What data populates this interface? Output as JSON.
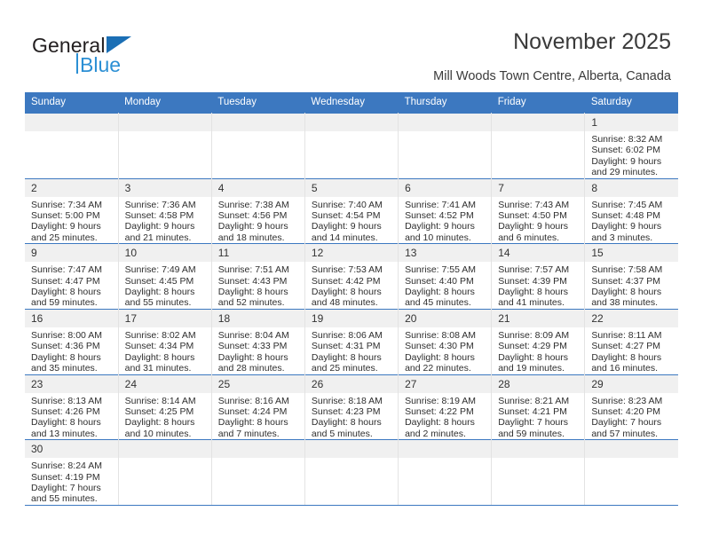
{
  "brand": {
    "name_top": "General",
    "name_bottom": "Blue",
    "triangle_color": "#1b6fb5",
    "blue_color": "#2b8fd4"
  },
  "header": {
    "title": "November 2025",
    "subtitle": "Mill Woods Town Centre, Alberta, Canada",
    "header_bg_color": "#3c78c0",
    "daynum_bg_color": "#f0f0f0"
  },
  "calendar": {
    "weekday_headers": [
      "Sunday",
      "Monday",
      "Tuesday",
      "Wednesday",
      "Thursday",
      "Friday",
      "Saturday"
    ],
    "weeks": [
      [
        {
          "day": "",
          "empty": true
        },
        {
          "day": "",
          "empty": true
        },
        {
          "day": "",
          "empty": true
        },
        {
          "day": "",
          "empty": true
        },
        {
          "day": "",
          "empty": true
        },
        {
          "day": "",
          "empty": true
        },
        {
          "day": "1",
          "sunrise": "Sunrise: 8:32 AM",
          "sunset": "Sunset: 6:02 PM",
          "daylight": "Daylight: 9 hours and 29 minutes."
        }
      ],
      [
        {
          "day": "2",
          "sunrise": "Sunrise: 7:34 AM",
          "sunset": "Sunset: 5:00 PM",
          "daylight": "Daylight: 9 hours and 25 minutes."
        },
        {
          "day": "3",
          "sunrise": "Sunrise: 7:36 AM",
          "sunset": "Sunset: 4:58 PM",
          "daylight": "Daylight: 9 hours and 21 minutes."
        },
        {
          "day": "4",
          "sunrise": "Sunrise: 7:38 AM",
          "sunset": "Sunset: 4:56 PM",
          "daylight": "Daylight: 9 hours and 18 minutes."
        },
        {
          "day": "5",
          "sunrise": "Sunrise: 7:40 AM",
          "sunset": "Sunset: 4:54 PM",
          "daylight": "Daylight: 9 hours and 14 minutes."
        },
        {
          "day": "6",
          "sunrise": "Sunrise: 7:41 AM",
          "sunset": "Sunset: 4:52 PM",
          "daylight": "Daylight: 9 hours and 10 minutes."
        },
        {
          "day": "7",
          "sunrise": "Sunrise: 7:43 AM",
          "sunset": "Sunset: 4:50 PM",
          "daylight": "Daylight: 9 hours and 6 minutes."
        },
        {
          "day": "8",
          "sunrise": "Sunrise: 7:45 AM",
          "sunset": "Sunset: 4:48 PM",
          "daylight": "Daylight: 9 hours and 3 minutes."
        }
      ],
      [
        {
          "day": "9",
          "sunrise": "Sunrise: 7:47 AM",
          "sunset": "Sunset: 4:47 PM",
          "daylight": "Daylight: 8 hours and 59 minutes."
        },
        {
          "day": "10",
          "sunrise": "Sunrise: 7:49 AM",
          "sunset": "Sunset: 4:45 PM",
          "daylight": "Daylight: 8 hours and 55 minutes."
        },
        {
          "day": "11",
          "sunrise": "Sunrise: 7:51 AM",
          "sunset": "Sunset: 4:43 PM",
          "daylight": "Daylight: 8 hours and 52 minutes."
        },
        {
          "day": "12",
          "sunrise": "Sunrise: 7:53 AM",
          "sunset": "Sunset: 4:42 PM",
          "daylight": "Daylight: 8 hours and 48 minutes."
        },
        {
          "day": "13",
          "sunrise": "Sunrise: 7:55 AM",
          "sunset": "Sunset: 4:40 PM",
          "daylight": "Daylight: 8 hours and 45 minutes."
        },
        {
          "day": "14",
          "sunrise": "Sunrise: 7:57 AM",
          "sunset": "Sunset: 4:39 PM",
          "daylight": "Daylight: 8 hours and 41 minutes."
        },
        {
          "day": "15",
          "sunrise": "Sunrise: 7:58 AM",
          "sunset": "Sunset: 4:37 PM",
          "daylight": "Daylight: 8 hours and 38 minutes."
        }
      ],
      [
        {
          "day": "16",
          "sunrise": "Sunrise: 8:00 AM",
          "sunset": "Sunset: 4:36 PM",
          "daylight": "Daylight: 8 hours and 35 minutes."
        },
        {
          "day": "17",
          "sunrise": "Sunrise: 8:02 AM",
          "sunset": "Sunset: 4:34 PM",
          "daylight": "Daylight: 8 hours and 31 minutes."
        },
        {
          "day": "18",
          "sunrise": "Sunrise: 8:04 AM",
          "sunset": "Sunset: 4:33 PM",
          "daylight": "Daylight: 8 hours and 28 minutes."
        },
        {
          "day": "19",
          "sunrise": "Sunrise: 8:06 AM",
          "sunset": "Sunset: 4:31 PM",
          "daylight": "Daylight: 8 hours and 25 minutes."
        },
        {
          "day": "20",
          "sunrise": "Sunrise: 8:08 AM",
          "sunset": "Sunset: 4:30 PM",
          "daylight": "Daylight: 8 hours and 22 minutes."
        },
        {
          "day": "21",
          "sunrise": "Sunrise: 8:09 AM",
          "sunset": "Sunset: 4:29 PM",
          "daylight": "Daylight: 8 hours and 19 minutes."
        },
        {
          "day": "22",
          "sunrise": "Sunrise: 8:11 AM",
          "sunset": "Sunset: 4:27 PM",
          "daylight": "Daylight: 8 hours and 16 minutes."
        }
      ],
      [
        {
          "day": "23",
          "sunrise": "Sunrise: 8:13 AM",
          "sunset": "Sunset: 4:26 PM",
          "daylight": "Daylight: 8 hours and 13 minutes."
        },
        {
          "day": "24",
          "sunrise": "Sunrise: 8:14 AM",
          "sunset": "Sunset: 4:25 PM",
          "daylight": "Daylight: 8 hours and 10 minutes."
        },
        {
          "day": "25",
          "sunrise": "Sunrise: 8:16 AM",
          "sunset": "Sunset: 4:24 PM",
          "daylight": "Daylight: 8 hours and 7 minutes."
        },
        {
          "day": "26",
          "sunrise": "Sunrise: 8:18 AM",
          "sunset": "Sunset: 4:23 PM",
          "daylight": "Daylight: 8 hours and 5 minutes."
        },
        {
          "day": "27",
          "sunrise": "Sunrise: 8:19 AM",
          "sunset": "Sunset: 4:22 PM",
          "daylight": "Daylight: 8 hours and 2 minutes."
        },
        {
          "day": "28",
          "sunrise": "Sunrise: 8:21 AM",
          "sunset": "Sunset: 4:21 PM",
          "daylight": "Daylight: 7 hours and 59 minutes."
        },
        {
          "day": "29",
          "sunrise": "Sunrise: 8:23 AM",
          "sunset": "Sunset: 4:20 PM",
          "daylight": "Daylight: 7 hours and 57 minutes."
        }
      ],
      [
        {
          "day": "30",
          "sunrise": "Sunrise: 8:24 AM",
          "sunset": "Sunset: 4:19 PM",
          "daylight": "Daylight: 7 hours and 55 minutes."
        },
        {
          "day": "",
          "empty": true
        },
        {
          "day": "",
          "empty": true
        },
        {
          "day": "",
          "empty": true
        },
        {
          "day": "",
          "empty": true
        },
        {
          "day": "",
          "empty": true
        },
        {
          "day": "",
          "empty": true
        }
      ]
    ]
  }
}
